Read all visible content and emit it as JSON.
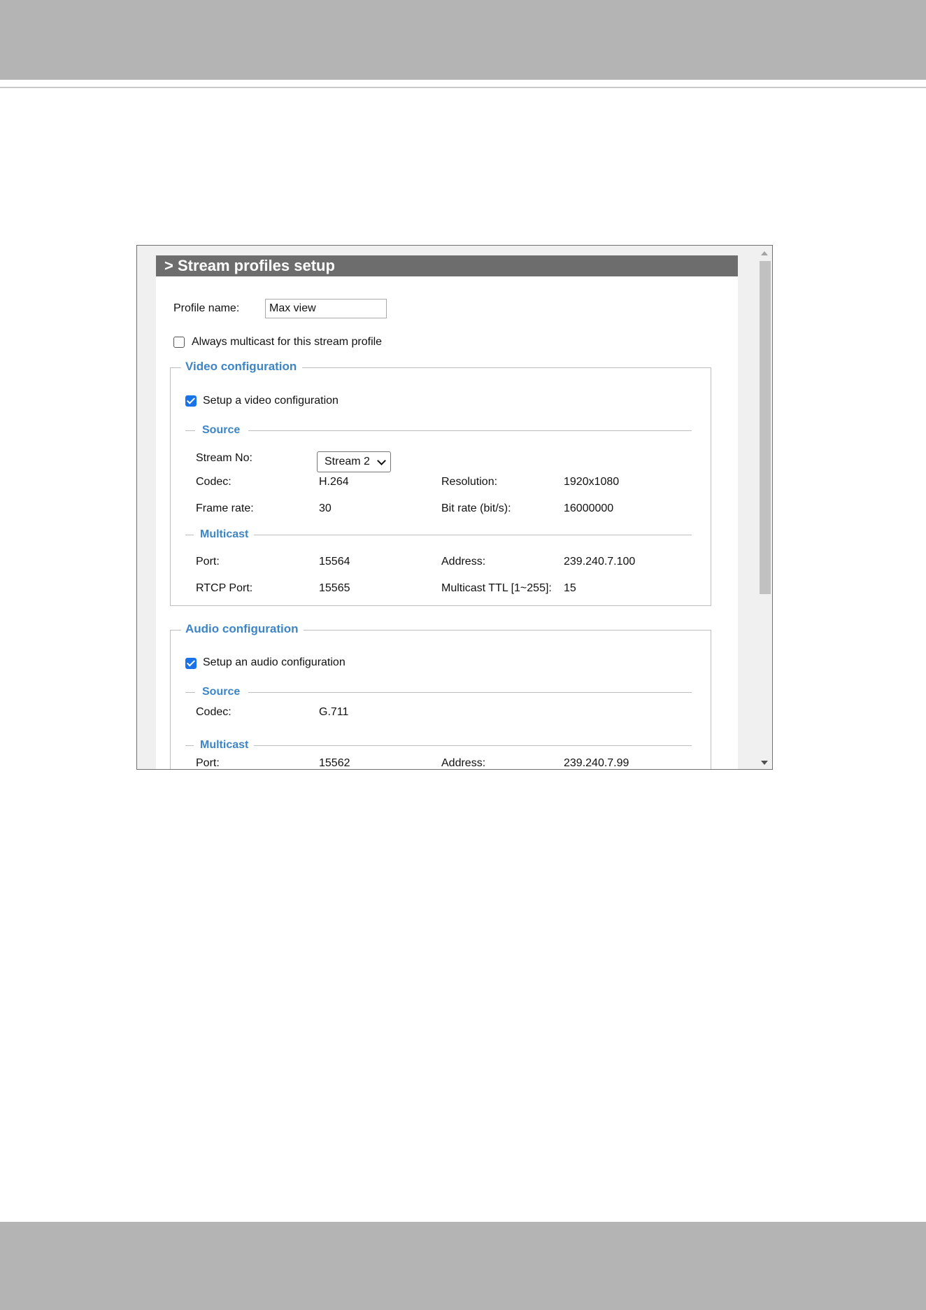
{
  "title": "> Stream profiles setup",
  "profile": {
    "name_label": "Profile name:",
    "name_value": "Max view",
    "always_multicast_label": "Always multicast for this stream profile",
    "always_multicast_checked": false
  },
  "video": {
    "legend": "Video configuration",
    "setup_label": "Setup a video configuration",
    "setup_checked": true,
    "source_heading": "Source",
    "stream_no_label": "Stream No:",
    "stream_no_value": "Stream 2",
    "codec_label": "Codec:",
    "codec_value": "H.264",
    "resolution_label": "Resolution:",
    "resolution_value": "1920x1080",
    "frame_rate_label": "Frame rate:",
    "frame_rate_value": "30",
    "bit_rate_label": "Bit rate (bit/s):",
    "bit_rate_value": "16000000",
    "multicast_heading": "Multicast",
    "port_label": "Port:",
    "port_value": "15564",
    "address_label": "Address:",
    "address_value": "239.240.7.100",
    "rtcp_port_label": "RTCP Port:",
    "rtcp_port_value": "15565",
    "ttl_label": "Multicast TTL [1~255]:",
    "ttl_value": "15"
  },
  "audio": {
    "legend": "Audio configuration",
    "setup_label": "Setup an audio configuration",
    "setup_checked": true,
    "source_heading": "Source",
    "codec_label": "Codec:",
    "codec_value": "G.711",
    "multicast_heading": "Multicast",
    "port_label": "Port:",
    "port_value": "15562",
    "address_label": "Address:",
    "address_value": "239.240.7.99"
  },
  "colors": {
    "accent": "#3d85c6",
    "title_bar": "#6d6d6d",
    "checkbox": "#1a73e8",
    "band": "#b4b4b4"
  }
}
